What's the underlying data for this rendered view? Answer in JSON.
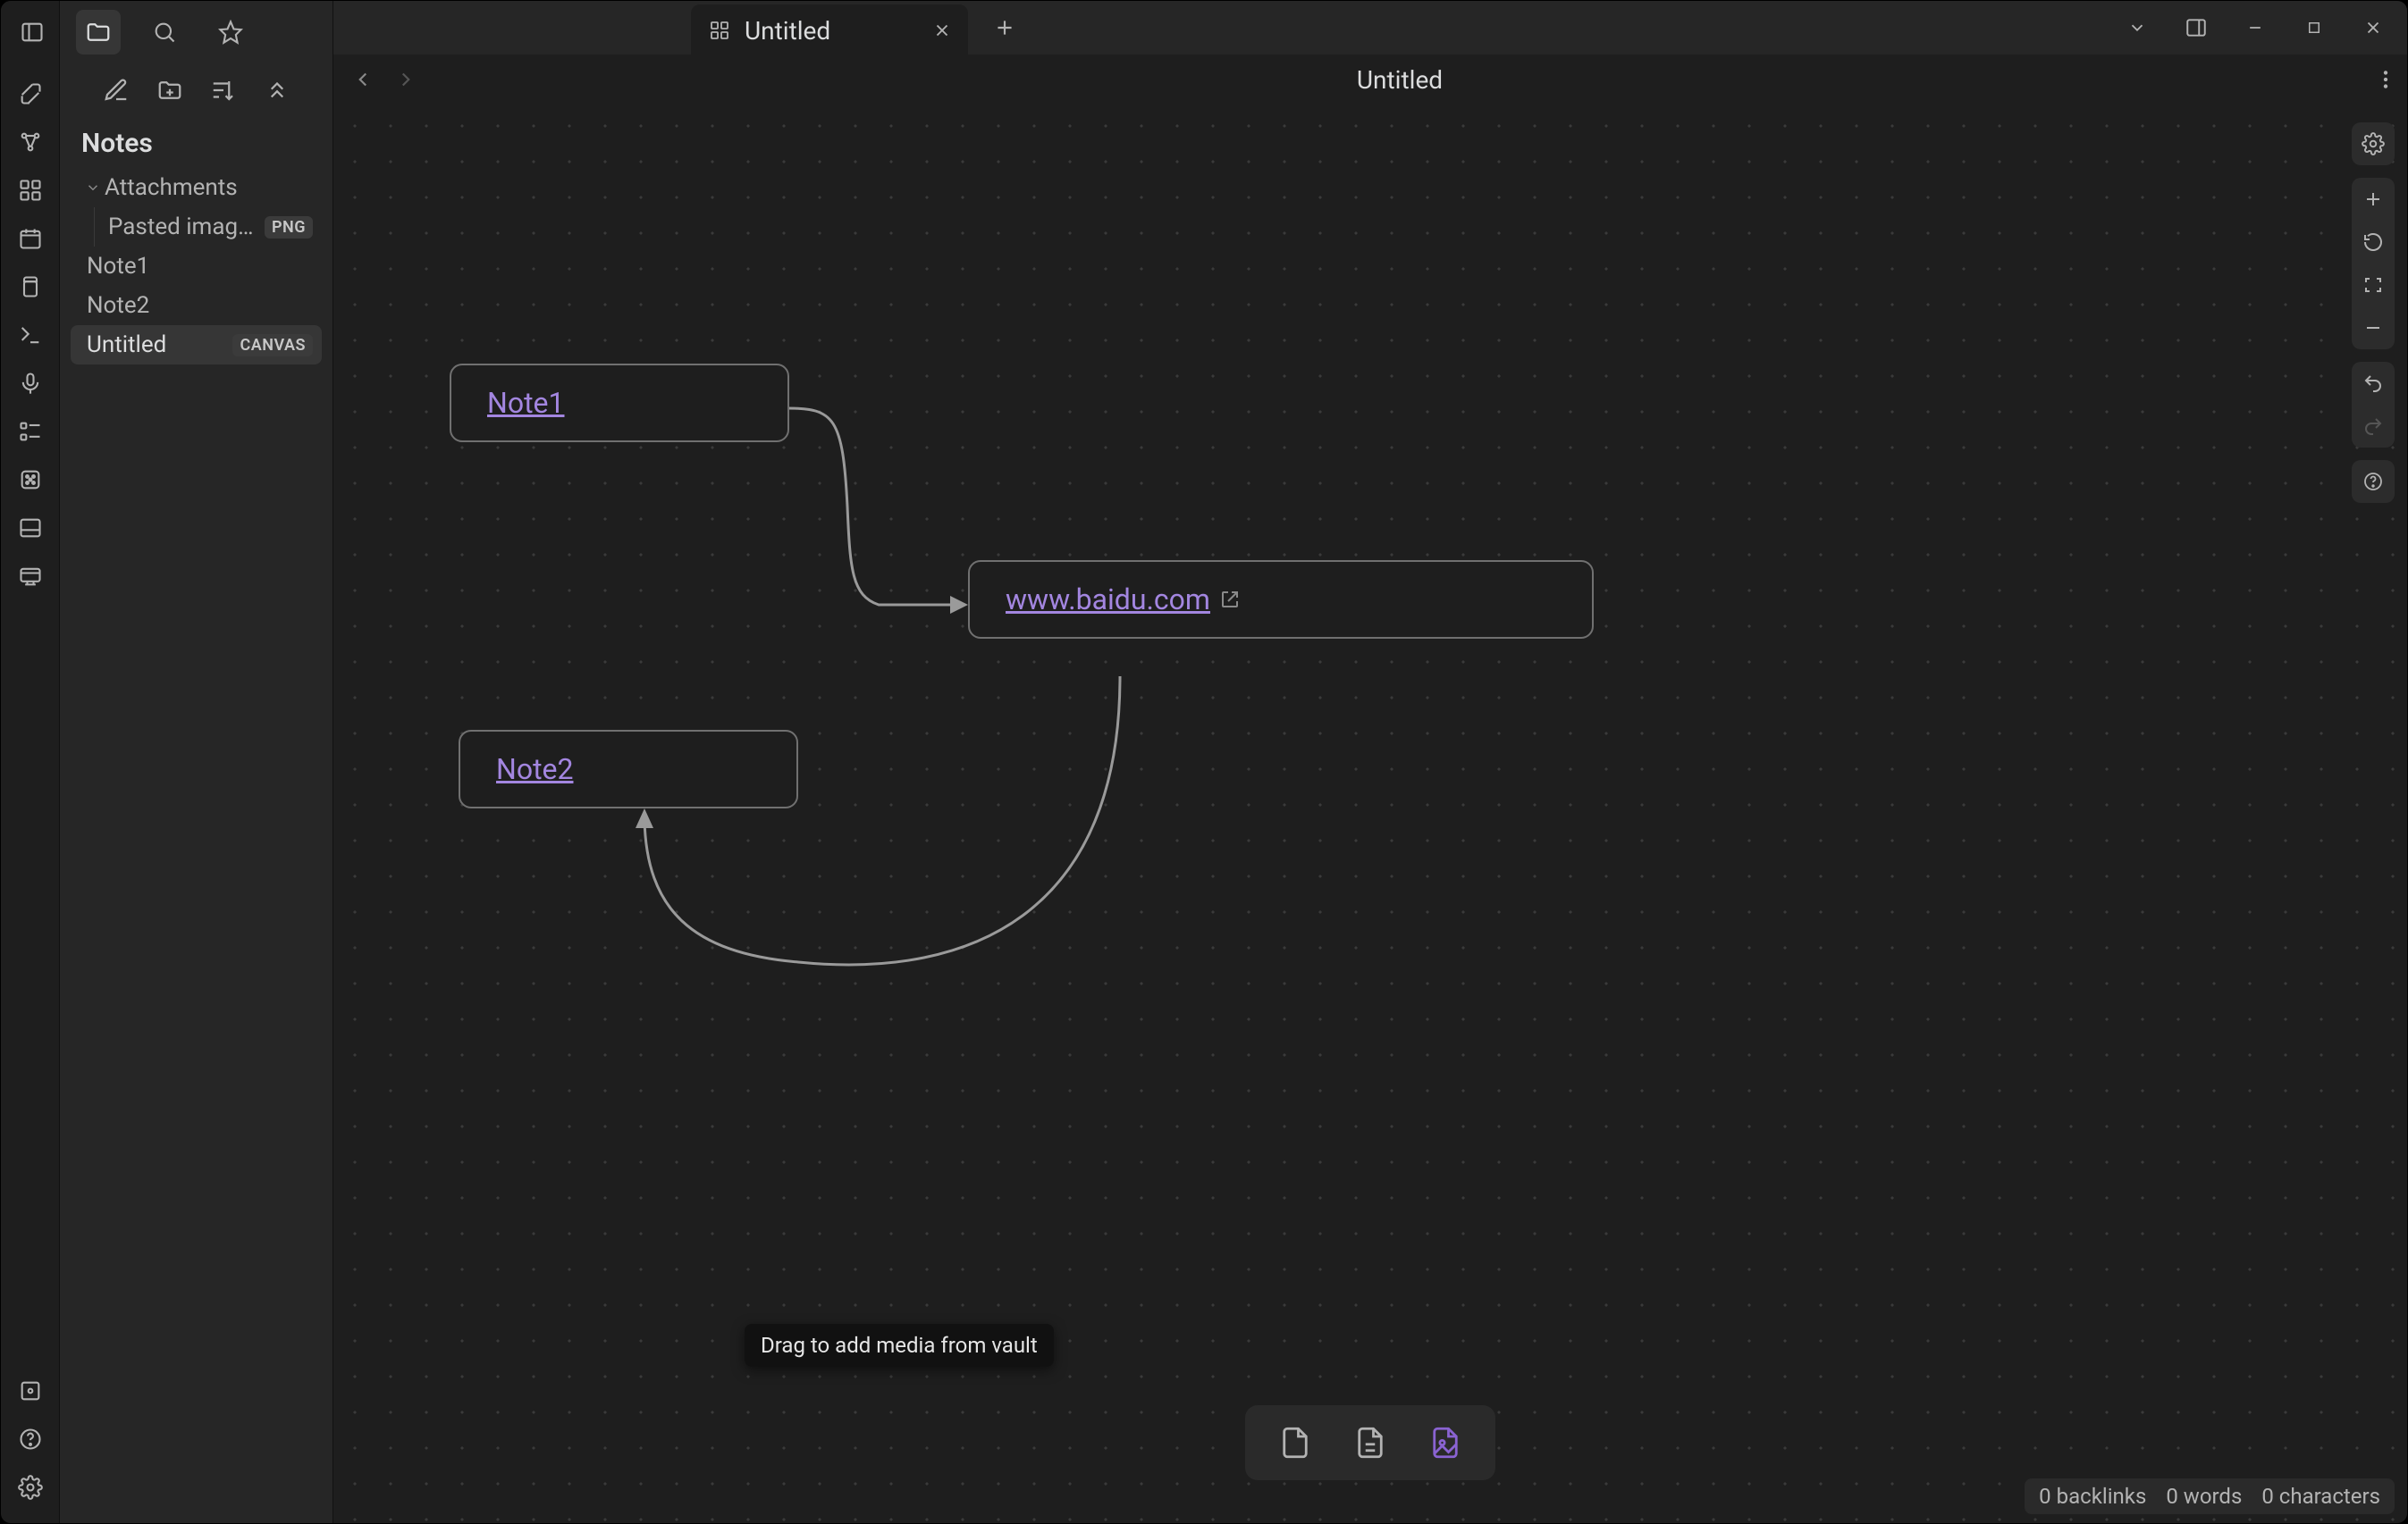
{
  "window": {
    "tab_title": "Untitled",
    "subheader_title": "Untitled"
  },
  "vault": {
    "title": "Notes"
  },
  "tree": {
    "folder_attachments": {
      "label": "Attachments",
      "expanded": true
    },
    "pasted_image": {
      "label": "Pasted image 20…",
      "tag": "PNG"
    },
    "note1": {
      "label": "Note1"
    },
    "note2": {
      "label": "Note2"
    },
    "untitled": {
      "label": "Untitled",
      "tag": "CANVAS"
    }
  },
  "canvas": {
    "nodes": {
      "note1": {
        "label": "Note1"
      },
      "note2": {
        "label": "Note2"
      },
      "baidu": {
        "label": "www.baidu.com"
      }
    },
    "tooltip": "Drag to add media from vault"
  },
  "status": {
    "backlinks": "0 backlinks",
    "words": "0 words",
    "characters": "0 characters"
  }
}
